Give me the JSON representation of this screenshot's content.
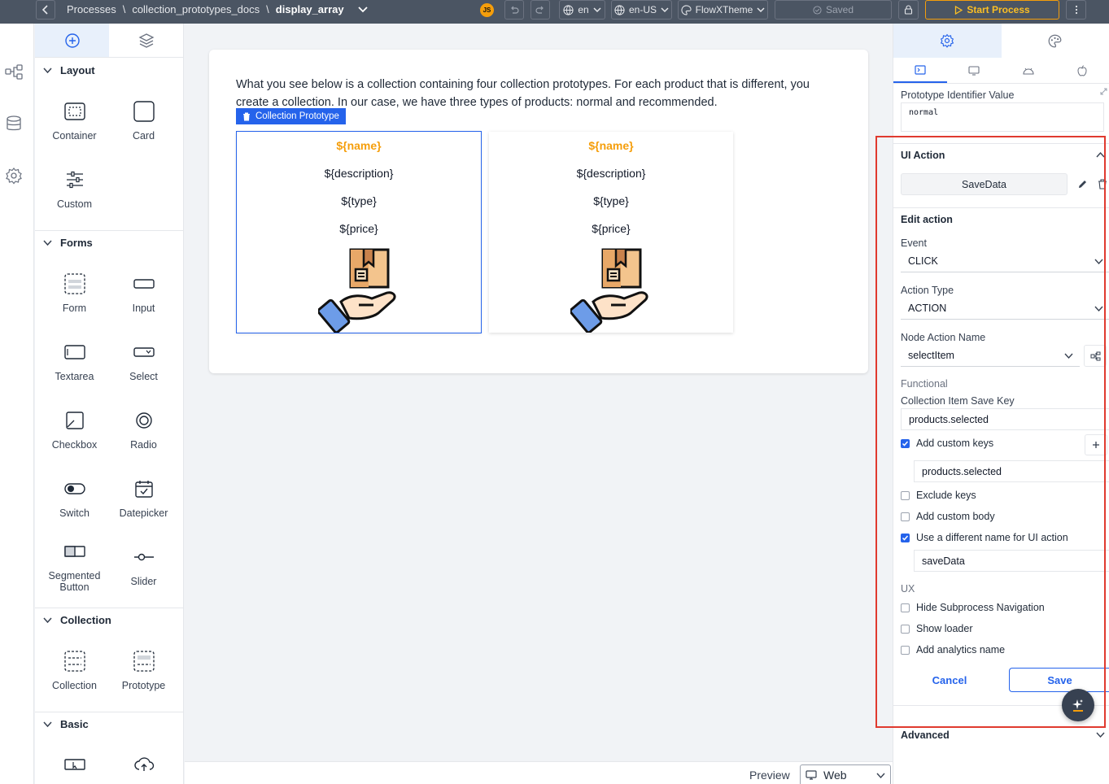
{
  "topbar": {
    "breadcrumbs": [
      "Processes",
      "\\",
      "collection_prototypes_docs",
      "\\"
    ],
    "current": "display_array",
    "avatar": "JS",
    "language": "en",
    "locale": "en-US",
    "theme": "FlowXTheme",
    "saved_label": "Saved",
    "start_label": "Start Process"
  },
  "components": {
    "sections": [
      {
        "title": "Layout",
        "items": [
          "Container",
          "Card",
          "Custom"
        ]
      },
      {
        "title": "Forms",
        "items": [
          "Form",
          "Input",
          "Textarea",
          "Select",
          "Checkbox",
          "Radio",
          "Switch",
          "Datepicker",
          "Segmented Button",
          "Slider"
        ]
      },
      {
        "title": "Collection",
        "items": [
          "Collection",
          "Prototype"
        ]
      },
      {
        "title": "Basic",
        "items": []
      }
    ]
  },
  "canvas": {
    "description": "What you see below is a collection containing four collection prototypes. For each product that is different, you create a collection. In our case, we have three types of products: normal and recommended.",
    "prototype_tag": "Collection Prototype",
    "card": {
      "name": "${name}",
      "description": "${description}",
      "type": "${type}",
      "price": "${price}"
    },
    "preview_label": "Preview",
    "preview_mode": "Web"
  },
  "properties": {
    "prototype_identifier_label": "Prototype Identifier Value",
    "prototype_identifier_value": "normal",
    "ui_action_title": "UI Action",
    "ui_action_name": "SaveData",
    "edit_action_title": "Edit action",
    "event_label": "Event",
    "event_value": "CLICK",
    "action_type_label": "Action Type",
    "action_type_value": "ACTION",
    "node_action_label": "Node Action Name",
    "node_action_value": "selectItem",
    "functional_label": "Functional",
    "save_key_label": "Collection Item Save Key",
    "save_key_value": "products.selected",
    "custom_keys_label": "Add custom keys",
    "custom_keys_value": "products.selected",
    "exclude_keys_label": "Exclude keys",
    "custom_body_label": "Add custom body",
    "diff_name_label": "Use a different name for UI action",
    "diff_name_value": "saveData",
    "ux_label": "UX",
    "hide_nav_label": "Hide Subprocess Navigation",
    "show_loader_label": "Show loader",
    "analytics_label": "Add analytics name",
    "cancel_label": "Cancel",
    "save_label": "Save",
    "advanced_label": "Advanced"
  },
  "colors": {
    "accent": "#2563eb",
    "name_field": "#f59e0b",
    "highlight_box": "#e03a2f",
    "topbar": "#4b5563"
  }
}
